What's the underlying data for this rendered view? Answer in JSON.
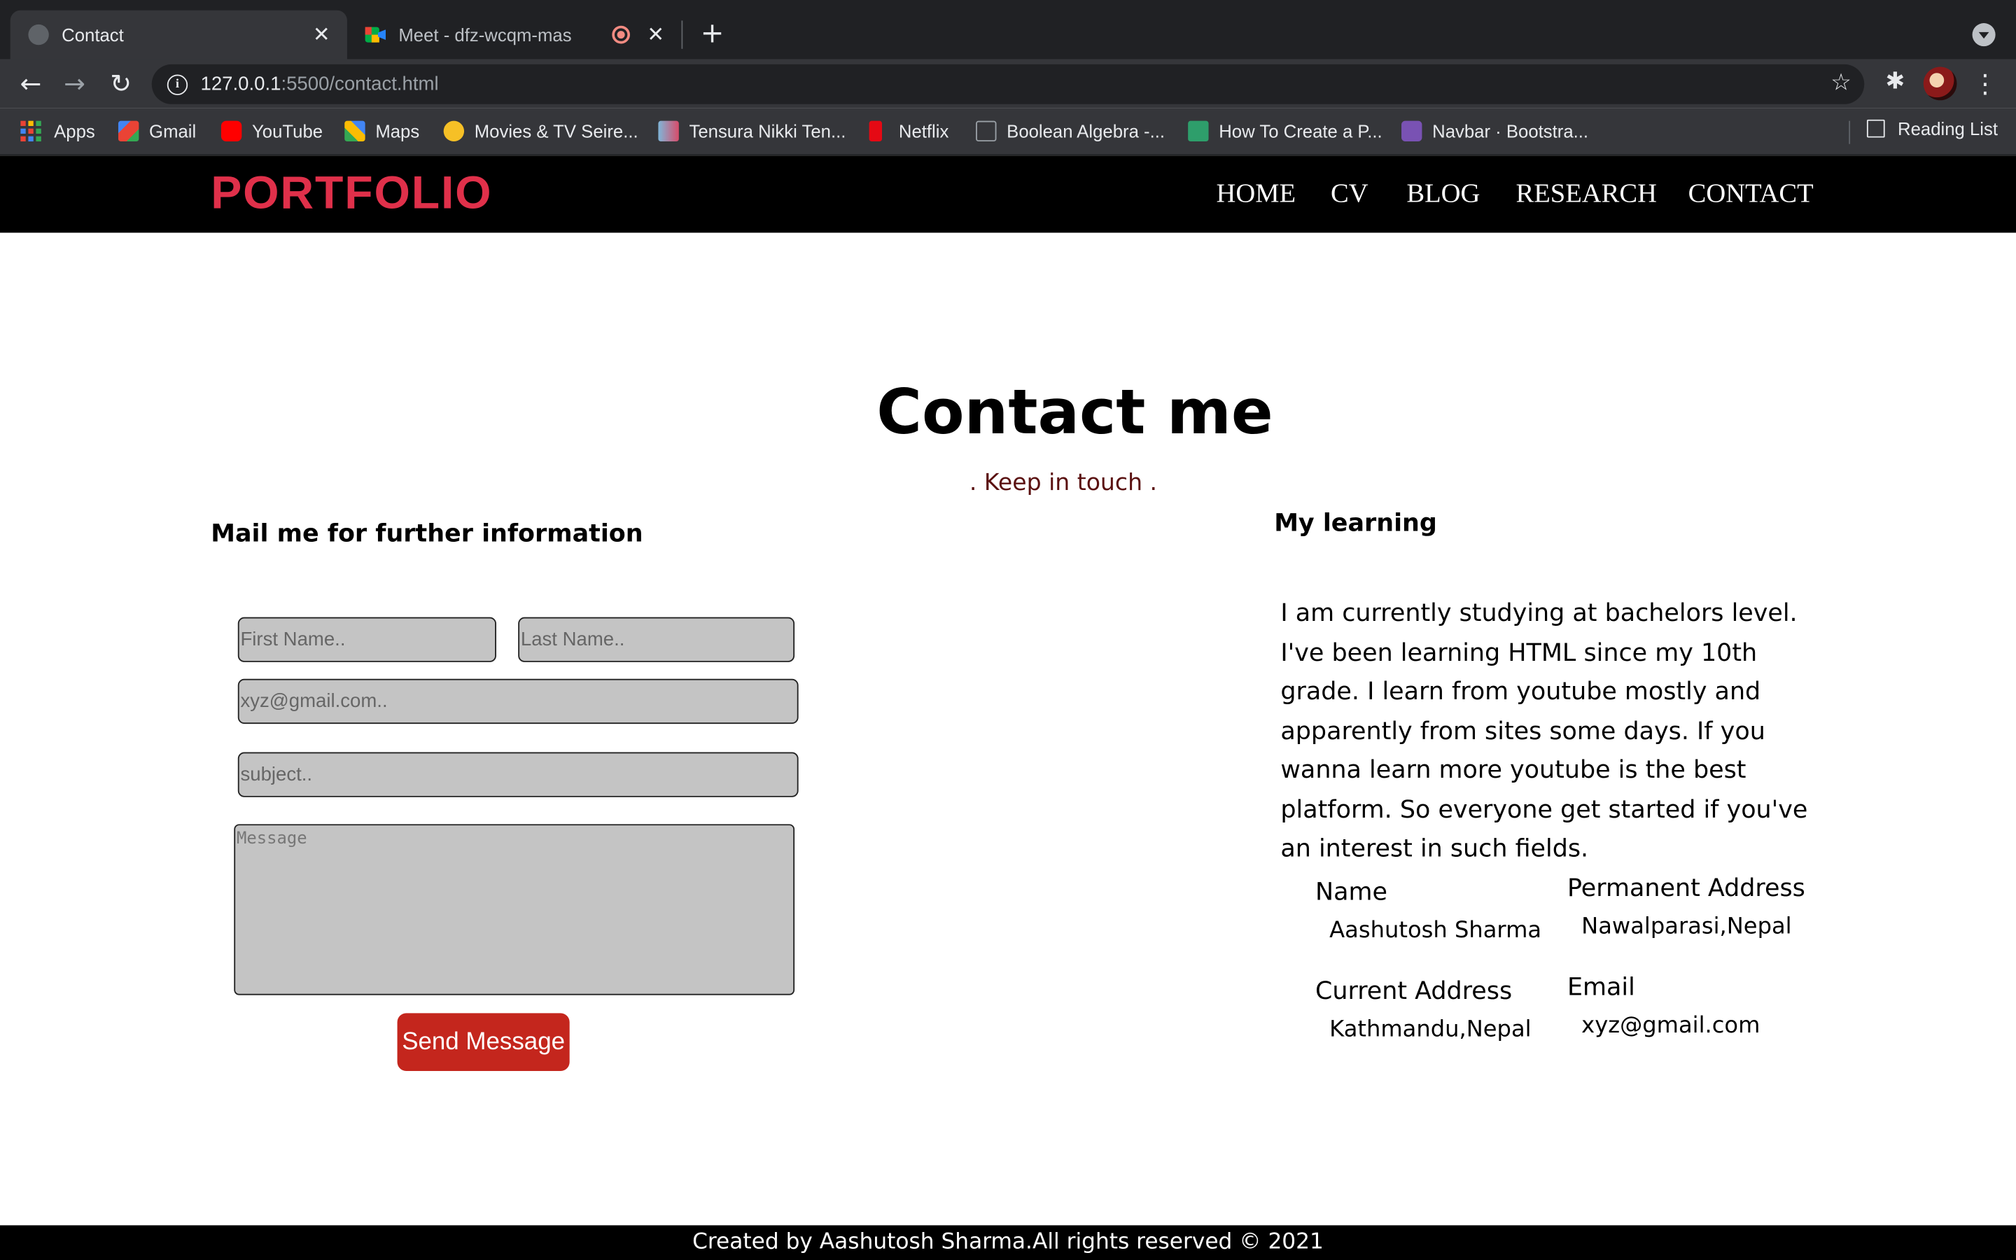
{
  "browser": {
    "tabs": [
      {
        "title": "Contact",
        "active": true
      },
      {
        "title": "Meet - dfz-wcqm-mas",
        "active": false
      }
    ],
    "close_glyph": "✕",
    "newtab_glyph": "+",
    "url_host": "127.0.0.1",
    "url_rest": ":5500/contact.html",
    "bookmarks": [
      {
        "label": "Apps",
        "icon": "apps-grid-icon"
      },
      {
        "label": "Gmail",
        "icon": "gmail-icon"
      },
      {
        "label": "YouTube",
        "icon": "youtube-icon"
      },
      {
        "label": "Maps",
        "icon": "maps-icon"
      },
      {
        "label": "Movies & TV Seire...",
        "icon": "movies-icon"
      },
      {
        "label": "Tensura Nikki Ten...",
        "icon": "tensura-icon"
      },
      {
        "label": "Netflix",
        "icon": "netflix-icon"
      },
      {
        "label": "Boolean Algebra -...",
        "icon": "boolean-icon"
      },
      {
        "label": "How To Create a P...",
        "icon": "wix-icon"
      },
      {
        "label": "Navbar · Bootstra...",
        "icon": "bootstrap-icon"
      }
    ],
    "reading_list": "Reading List"
  },
  "site": {
    "brand": "PORTFOLIO",
    "nav": [
      "HOME",
      "CV",
      "BLOG",
      "RESEARCH",
      "CONTACT"
    ],
    "title": "Contact me",
    "tagline": ". Keep in touch .",
    "form": {
      "heading": "Mail me for further information",
      "first_name_placeholder": "First Name..",
      "last_name_placeholder": "Last Name..",
      "email_placeholder": "xyz@gmail.com..",
      "subject_placeholder": "subject..",
      "message_placeholder": "Message",
      "send_label": "Send Message"
    },
    "learning": {
      "heading": "My learning",
      "text": "I am currently studying at bachelors level. I've been learning HTML since my 10th grade. I learn from youtube mostly and apparently from sites some days. If you wanna learn more youtube is the best platform. So everyone get started if you've an interest in such fields."
    },
    "info": {
      "name_label": "Name",
      "name_value": "Aashutosh Sharma",
      "perm_label": "Permanent Address",
      "perm_value": "Nawalparasi,Nepal",
      "current_label": "Current Address",
      "current_value": "Kathmandu,Nepal",
      "email_label": "Email",
      "email_value": "xyz@gmail.com"
    },
    "footer": "Created by Aashutosh Sharma.All rights reserved © 2021"
  },
  "colors": {
    "brand": "#e0304a",
    "button": "#c4261d",
    "tagline": "#5a1010"
  }
}
